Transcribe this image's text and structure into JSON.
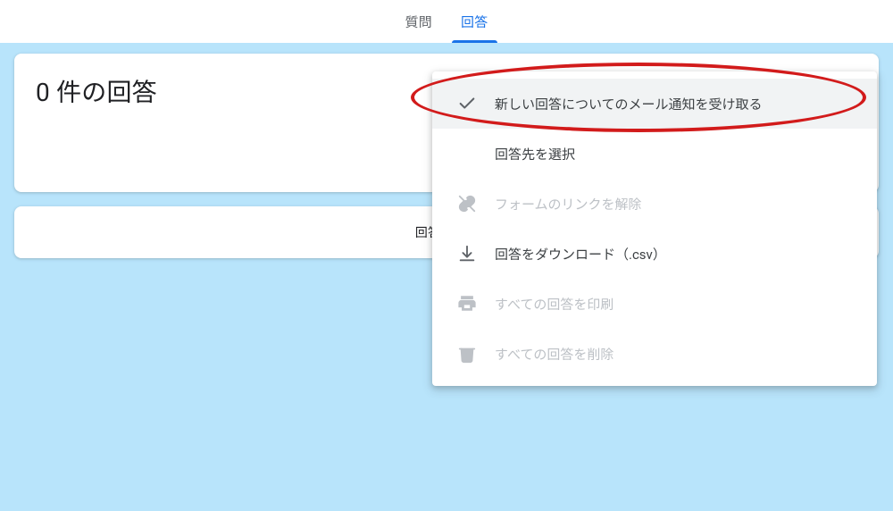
{
  "tabs": {
    "questions": "質問",
    "responses": "回答"
  },
  "heading": "0 件の回答",
  "card2_text": "回答を受け",
  "menu": {
    "email_notify": "新しい回答についてのメール通知を受け取る",
    "select_destination": "回答先を選択",
    "unlink_form": "フォームのリンクを解除",
    "download_csv": "回答をダウンロード（.csv）",
    "print_all": "すべての回答を印刷",
    "delete_all": "すべての回答を削除"
  }
}
